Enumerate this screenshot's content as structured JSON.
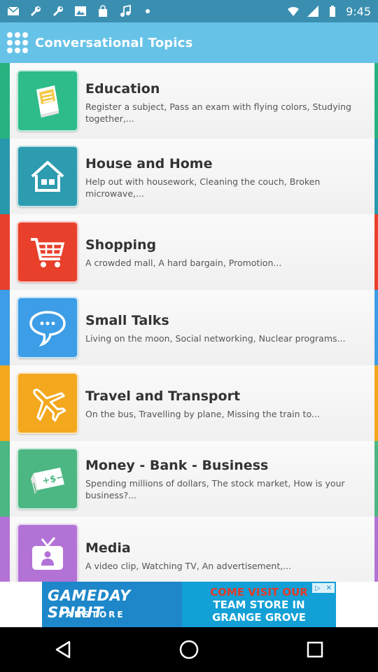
{
  "status_bar": {
    "time": "9:45",
    "left_icons": [
      "mail-icon",
      "wrench-icon",
      "wrench-icon",
      "image-icon",
      "shopping-bag-icon",
      "music-icon",
      "dot-icon"
    ],
    "right_icons": [
      "wifi-icon",
      "signal-icon",
      "battery-icon"
    ]
  },
  "app_bar": {
    "title": "Conversational Topics",
    "color": "#67c2e7"
  },
  "topics": [
    {
      "title": "Education",
      "description": "Register a subject, Pass an exam with flying colors, Studying together,...",
      "icon": "book-icon",
      "color": "#2ebc8a",
      "stripe": "#29b27f"
    },
    {
      "title": "House and Home",
      "description": "Help out with housework, Cleaning the couch, Broken microwave,...",
      "icon": "house-icon",
      "color": "#2d9bb0",
      "stripe": "#2898ad"
    },
    {
      "title": "Shopping",
      "description": "A crowded mall, A hard bargain, Promotion...",
      "icon": "cart-icon",
      "color": "#e8402b",
      "stripe": "#e8402b"
    },
    {
      "title": "Small Talks",
      "description": "Living on the moon, Social networking, Nuclear programs...",
      "icon": "chat-bubble-icon",
      "color": "#3d9de6",
      "stripe": "#3d9de6"
    },
    {
      "title": "Travel and Transport",
      "description": "On the bus, Travelling by plane, Missing the train to...",
      "icon": "airplane-icon",
      "color": "#f3a81e",
      "stripe": "#f3a81e"
    },
    {
      "title": "Money - Bank - Business",
      "description": "Spending millions of dollars, The stock market, How is your business?...",
      "icon": "money-icon",
      "color": "#4cb782",
      "stripe": "#4cb782"
    },
    {
      "title": "Media",
      "description": "A video clip, Watching TV, An advertisement,...",
      "icon": "tv-icon",
      "color": "#b373d6",
      "stripe": "#b373d6"
    }
  ],
  "ad": {
    "brand": "GAMEDAY SPIRIT",
    "sub": "FANSTORE",
    "line1": "COME VISIT OUR",
    "line2": "TEAM STORE IN",
    "line3": "GRANGE GROVE"
  },
  "nav": [
    "back-icon",
    "home-icon",
    "recents-icon"
  ]
}
